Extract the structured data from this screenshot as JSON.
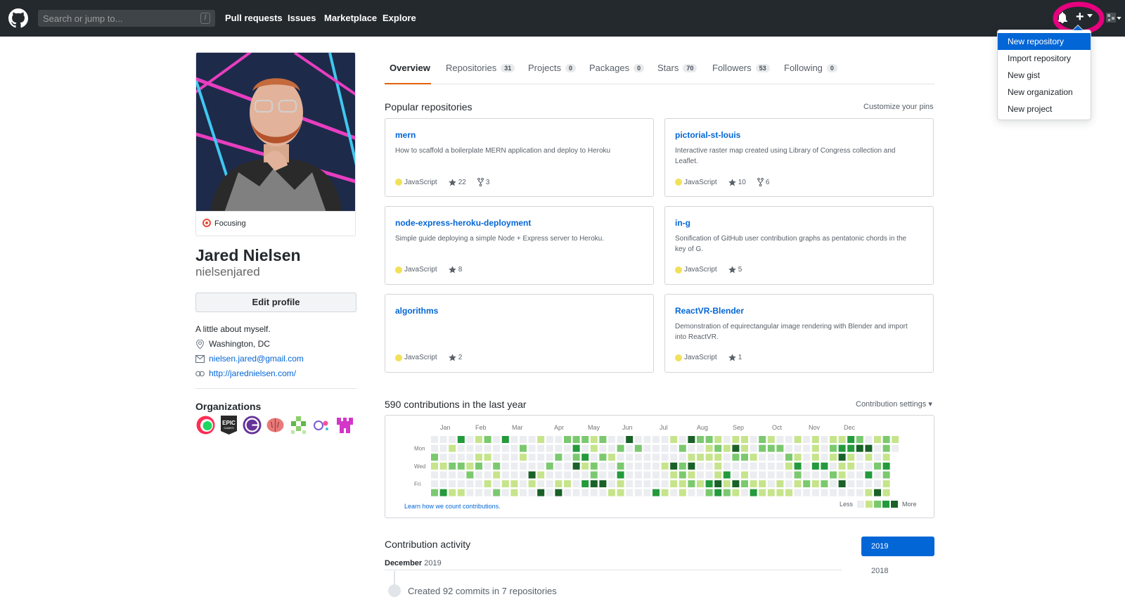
{
  "header": {
    "search_placeholder": "Search or jump to...",
    "search_shortcut": "/",
    "nav": [
      {
        "label": "Pull requests"
      },
      {
        "label": "Issues"
      },
      {
        "label": "Marketplace"
      },
      {
        "label": "Explore"
      }
    ],
    "plus_label": "+"
  },
  "create_menu": {
    "items": [
      {
        "label": "New repository",
        "active": true
      },
      {
        "label": "Import repository"
      },
      {
        "label": "New gist"
      },
      {
        "label": "New organization"
      },
      {
        "label": "New project"
      }
    ]
  },
  "profile": {
    "status": "Focusing",
    "full_name": "Jared Nielsen",
    "username": "nielsenjared",
    "edit_button": "Edit profile",
    "bio": "A little about myself.",
    "location": "Washington, DC",
    "email": "nielsen.jared@gmail.com",
    "website": "http://jarednielsen.com/",
    "organizations_title": "Organizations"
  },
  "tabs": [
    {
      "label": "Overview",
      "count": "",
      "selected": true
    },
    {
      "label": "Repositories",
      "count": "31"
    },
    {
      "label": "Projects",
      "count": "0"
    },
    {
      "label": "Packages",
      "count": "0"
    },
    {
      "label": "Stars",
      "count": "70"
    },
    {
      "label": "Followers",
      "count": "53"
    },
    {
      "label": "Following",
      "count": "0"
    }
  ],
  "pinned": {
    "title": "Popular repositories",
    "customize_link": "Customize your pins",
    "repos": [
      {
        "name": "mern",
        "description": "How to scaffold a boilerplate MERN application and deploy to Heroku",
        "language": "JavaScript",
        "stars": "22",
        "forks": "3"
      },
      {
        "name": "pictorial-st-louis",
        "description": "Interactive raster map created using Library of Congress collection and Leaflet.",
        "language": "JavaScript",
        "stars": "10",
        "forks": "6"
      },
      {
        "name": "node-express-heroku-deployment",
        "description": "Simple guide deploying a simple Node + Express server to Heroku.",
        "language": "JavaScript",
        "stars": "8",
        "forks": ""
      },
      {
        "name": "in-g",
        "description": "Sonification of GitHub user contribution graphs as pentatonic chords in the key of G.",
        "language": "JavaScript",
        "stars": "5",
        "forks": ""
      },
      {
        "name": "algorithms",
        "description": "",
        "language": "JavaScript",
        "stars": "2",
        "forks": ""
      },
      {
        "name": "ReactVR-Blender",
        "description": "Demonstration of equirectangular image rendering with Blender and import into ReactVR.",
        "language": "JavaScript",
        "stars": "1",
        "forks": ""
      }
    ],
    "language_color": "#f1e05a"
  },
  "contributions": {
    "title": "590 contributions in the last year",
    "settings_label": "Contribution settings ▾",
    "months": [
      "Jan",
      "Feb",
      "Mar",
      "Apr",
      "May",
      "Jun",
      "Jul",
      "Aug",
      "Sep",
      "Oct",
      "Nov",
      "Dec"
    ],
    "day_labels": [
      "Mon",
      "Wed",
      "Fri"
    ],
    "learn_link": "Learn how we count contributions.",
    "legend_less": "Less",
    "legend_more": "More",
    "colors": [
      "#ebedf0",
      "#c6e48b",
      "#7bc96f",
      "#239a3b",
      "#196127"
    ]
  },
  "activity": {
    "title": "Contribution activity",
    "month": "December",
    "year": "2019",
    "item": "Created 92 commits in 7 repositories",
    "years": [
      {
        "label": "2019",
        "active": true
      },
      {
        "label": "2018"
      }
    ]
  },
  "annotation": {
    "highlight_color": "#e6007e"
  }
}
